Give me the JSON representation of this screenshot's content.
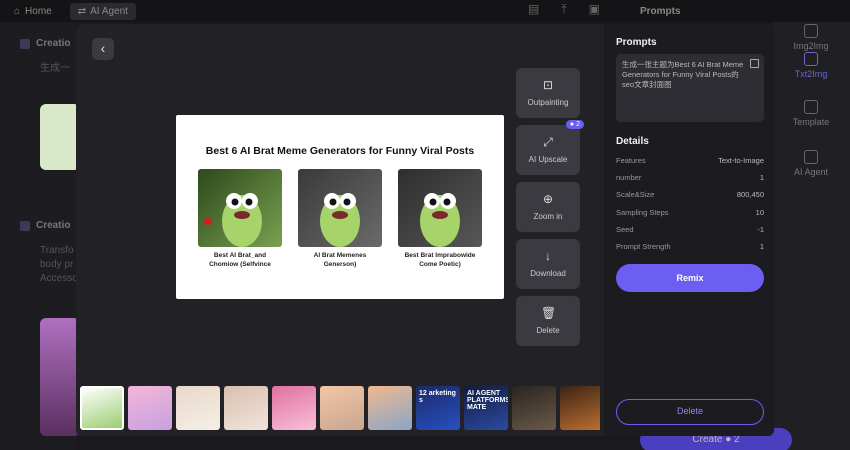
{
  "background": {
    "topbar": {
      "home": "Home",
      "agent": "AI Agent"
    },
    "prompts_title": "Prompts",
    "section1_title": "Creatio",
    "section1_sub": "生成一",
    "section2_title": "Creatio",
    "section2_lines": [
      "Transfo",
      "body pr",
      "Accesso"
    ],
    "right_items": [
      "Img2Img",
      "Txt2Img",
      "Template",
      "AI Agent"
    ],
    "create_label": "Create",
    "create_cost": "2"
  },
  "modal": {
    "back_icon": "chevron-left-icon",
    "preview": {
      "title": "Best 6 AI Brat Meme Generators for Funny Viral Posts",
      "cards": [
        {
          "caption_line1": "Best AI Brat_and",
          "caption_line2": "Chomiow (Selfvince"
        },
        {
          "caption_line1": "AI Brat Memenes",
          "caption_line2": "Generson)"
        },
        {
          "caption_line1": "Best Brat Imprabowide",
          "caption_line2": "Come Poetic)"
        }
      ]
    },
    "tools": [
      {
        "label": "Outpainting",
        "icon": "outpaint-icon",
        "glyph": "⊡"
      },
      {
        "label": "AI Upscale",
        "icon": "upscale-icon",
        "glyph": "⤢",
        "badge": "2"
      },
      {
        "label": "Zoom in",
        "icon": "zoom-in-icon",
        "glyph": "⊕"
      },
      {
        "label": "Download",
        "icon": "download-icon",
        "glyph": "↓"
      },
      {
        "label": "Delete",
        "icon": "trash-icon",
        "glyph": "🗑"
      }
    ],
    "thumbnails": [
      {
        "text": "",
        "colors": [
          "#ffffff",
          "#9acd70"
        ],
        "selected": true
      },
      {
        "text": "",
        "colors": [
          "#f4b6d8",
          "#c8a0e0"
        ]
      },
      {
        "text": "",
        "colors": [
          "#e8d8c8",
          "#f6efe8"
        ]
      },
      {
        "text": "",
        "colors": [
          "#d9c0b0",
          "#f1e4da"
        ]
      },
      {
        "text": "",
        "colors": [
          "#e070a0",
          "#f8c0d8"
        ]
      },
      {
        "text": "",
        "colors": [
          "#f2c6a6",
          "#c8a690"
        ]
      },
      {
        "text": "",
        "colors": [
          "#f0b890",
          "#8aa6c8"
        ]
      },
      {
        "text": "12 arketing s",
        "colors": [
          "#1a2a6a",
          "#2850c0"
        ]
      },
      {
        "text": "AI AGENT PLATFORMS MATE",
        "colors": [
          "#101c40",
          "#2d4aa0"
        ]
      },
      {
        "text": "",
        "colors": [
          "#2a2420",
          "#6a5a4a"
        ]
      },
      {
        "text": "",
        "colors": [
          "#3a2416",
          "#c07030"
        ]
      }
    ],
    "side": {
      "prompts_title": "Prompts",
      "prompt_text": "生成一张主题为Best 6 AI Brat Meme Generators for Funny Viral Posts的seo文章封面图",
      "details_title": "Details",
      "details": [
        {
          "label": "Features",
          "value": "Text-to-Image"
        },
        {
          "label": "number",
          "value": "1"
        },
        {
          "label": "Scale&Size",
          "value": "800,450"
        },
        {
          "label": "Sampling Steps",
          "value": "10"
        },
        {
          "label": "Seed",
          "value": "-1"
        },
        {
          "label": "Prompt Strength",
          "value": "1"
        }
      ],
      "remix_label": "Remix",
      "delete_label": "Delete"
    }
  }
}
